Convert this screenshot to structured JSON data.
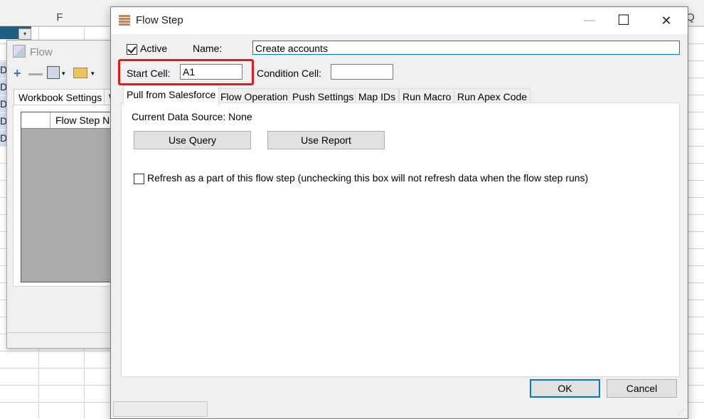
{
  "spreadsheet": {
    "column_headers": [
      "F",
      "Q"
    ],
    "row_prefix": "D",
    "row_count": 5
  },
  "flow_window": {
    "title": "Flow",
    "toolbar": {
      "add_icon": "plus-icon",
      "remove_icon": "minus-icon",
      "save_icon": "save-icon",
      "open_icon": "open-folder-icon"
    },
    "tab_label": "Workbook Settings",
    "tab_partial": "W",
    "grid_column_header": "Flow Step Na"
  },
  "dialog": {
    "title": "Flow Step",
    "window_buttons": {
      "minimize": "—",
      "maximize": "☐",
      "close": "✕"
    },
    "active_label": "Active",
    "active_checked": true,
    "name_label": "Name:",
    "name_value": "Create accounts",
    "start_cell_label": "Start Cell:",
    "start_cell_value": "A1",
    "condition_cell_label": "Condition Cell:",
    "condition_cell_value": "",
    "tabs": [
      "Pull from Salesforce",
      "Flow Operation",
      "Push Settings",
      "Map IDs",
      "Run Macro",
      "Run Apex Code"
    ],
    "active_tab": "Pull from Salesforce",
    "panel": {
      "data_source_text": "Current Data Source: None",
      "use_query_label": "Use Query",
      "use_report_label": "Use Report",
      "refresh_checked": false,
      "refresh_label": "Refresh as a part of this flow step (unchecking this box will not refresh data when the flow step runs)"
    },
    "ok_label": "OK",
    "cancel_label": "Cancel",
    "colors": {
      "highlight": "#e31b1b",
      "focus_border": "#0078d7",
      "excel_selection": "#1f5f84"
    }
  }
}
